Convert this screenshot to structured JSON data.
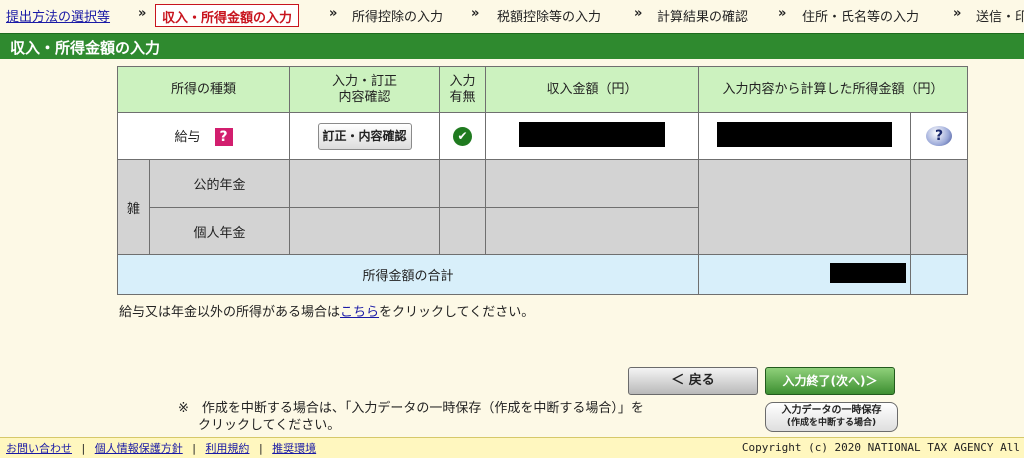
{
  "steps": {
    "items": [
      {
        "label": "提出方法の選択等",
        "state": "link"
      },
      {
        "label": "収入・所得金額の入力",
        "state": "current"
      },
      {
        "label": "所得控除の入力",
        "state": "normal"
      },
      {
        "label": "税額控除等の入力",
        "state": "normal"
      },
      {
        "label": "計算結果の確認",
        "state": "normal"
      },
      {
        "label": "住所・氏名等の入力",
        "state": "normal"
      },
      {
        "label": "送信・印",
        "state": "normal"
      }
    ],
    "separator": "»"
  },
  "title": "収入・所得金額の入力",
  "table": {
    "headers": {
      "kind": "所得の種類",
      "edit": "入力・訂正\n内容確認",
      "has_input": "入力\n有無",
      "income": "収入金額（円）",
      "computed": "入力内容から計算した所得金額（円）"
    },
    "rows": {
      "salary": {
        "label": "給与",
        "qmark": "?",
        "button": "訂正・内容確認",
        "check": "✔",
        "help": "?"
      },
      "misc": {
        "group": "雑",
        "pension_public": "公的年金",
        "pension_private": "個人年金"
      }
    },
    "total": {
      "label": "所得金額の合計"
    }
  },
  "note": {
    "before": "給与又は年金以外の所得がある場合は",
    "link": "こちら",
    "after": "をクリックしてください。"
  },
  "buttons": {
    "back": "＜ 戻る",
    "next": "入力終了(次へ)＞",
    "save_line1": "入力データの一時保存",
    "save_line2": "(作成を中断する場合)"
  },
  "interrupt_note": {
    "line1": "※　作成を中断する場合は、「入力データの一時保存（作成を中断する場合）」を",
    "line2": "クリックしてください。"
  },
  "footer": {
    "links": [
      "お問い合わせ",
      "個人情報保護方針",
      "利用規約",
      "推奨環境"
    ],
    "separator": "|",
    "copyright": "Copyright (c) 2020 NATIONAL TAX AGENCY All"
  },
  "colors": {
    "title_bar": "#2f8a2f",
    "current_step": "#c8141e",
    "header_bg": "#ccf2bf",
    "total_bg": "#d8effa",
    "next_button": "#3d8f31"
  }
}
